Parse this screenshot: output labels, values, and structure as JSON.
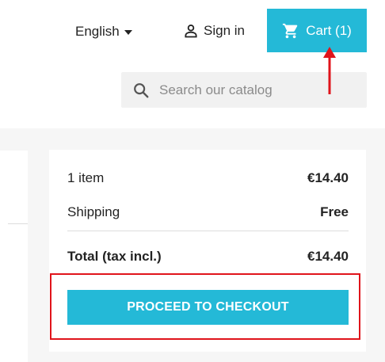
{
  "header": {
    "language": "English",
    "sign_in": "Sign in",
    "cart_label": "Cart (1)"
  },
  "search": {
    "placeholder": "Search our catalog"
  },
  "summary": {
    "items_label": "1 item",
    "items_value": "€14.40",
    "shipping_label": "Shipping",
    "shipping_value": "Free",
    "total_label": "Total (tax incl.)",
    "total_value": "€14.40",
    "checkout_label": "PROCEED TO CHECKOUT"
  },
  "colors": {
    "accent": "#24b9d7",
    "highlight": "#e0141b",
    "background": "#f6f6f6"
  },
  "icons": {
    "user": "user-icon",
    "cart": "shopping-cart-icon",
    "search": "search-icon",
    "caret": "caret-down-icon"
  }
}
